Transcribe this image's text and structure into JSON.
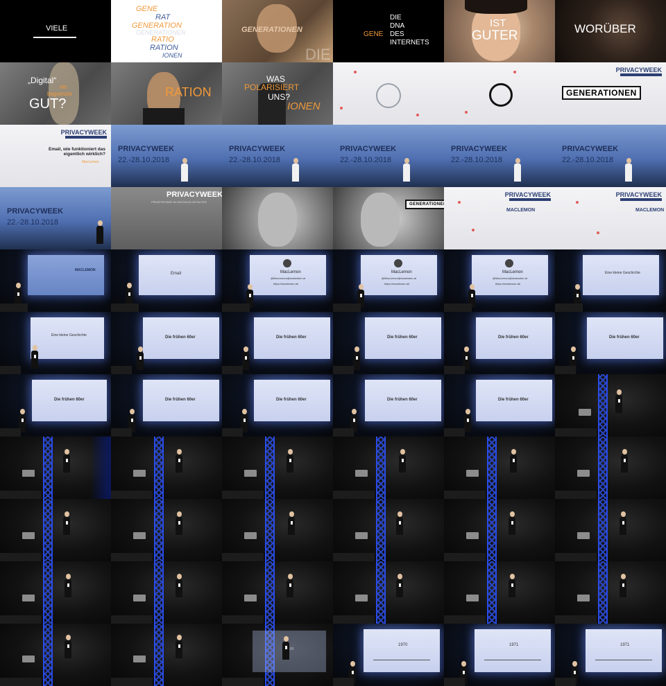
{
  "colors": {
    "accent_orange": "#f0993a",
    "accent_blue": "#3e5b99",
    "stage_truss": "#2c52ff"
  },
  "row1": {
    "c1": {
      "text": "VIELE"
    },
    "c2": {
      "words": [
        "GENE",
        "RAT",
        "GENERATION",
        "GENERATIONEN",
        "RATIO",
        "RATION",
        "IONEN"
      ]
    },
    "c3": {
      "overlay": "GENERATIONEN",
      "overlay2": "DIE"
    },
    "c4": {
      "left": "GENE",
      "right_lines": [
        "DIE",
        "DNA",
        "DES",
        "INTERNETS"
      ]
    },
    "c5": {
      "line1": "IST",
      "line2": "GUTER"
    },
    "c6": {
      "text": "WORÜBER"
    }
  },
  "row2": {
    "c1": {
      "quote": "„Digital“",
      "small1": "ein",
      "small2": "begrenzte",
      "big": "GUT?"
    },
    "c2": {
      "text": "RATION"
    },
    "c3": {
      "line1": "WAS",
      "line2": "POLARISIERT",
      "line3": "UNS?",
      "line4": "IONEN"
    },
    "c6": {
      "label": "GENERATIONEN"
    },
    "brand": "PRIVACYWEEK"
  },
  "row3": {
    "c1": {
      "brand": "PRIVACYWEEK",
      "question": "Email, wie funktioniert das eigentlich wirklich?",
      "author": "MacLemon"
    },
    "banner": {
      "title": "PRIVACYWEEK",
      "dates": "22.-28.10.2018"
    }
  },
  "row4": {
    "c1": {
      "title": "PRIVACYWEEK",
      "dates": "22.-28.10.2018"
    },
    "c2": {
      "title": "PRIVACYWEEK",
      "subtitle": "PRIVATSPHÄRE IM DIGITALEN ZEITALTER"
    },
    "c4": {
      "label": "GENERATIONEN"
    },
    "c5": {
      "brand": "PRIVACYWEEK",
      "name": "MACLEMON"
    },
    "c6": {
      "brand": "PRIVACYWEEK",
      "name": "MACLEMON"
    }
  },
  "stage_slides": {
    "maclemon": "MACLEMON",
    "email": "Email",
    "speaker": "MacLemon",
    "handle": "@MacLemon@mastodon.at",
    "site": "https://maclemon.at/",
    "story": "Eine kleine Geschichte",
    "sixties": "Die frühen 60er",
    "y1970": "1970",
    "y1971": "1971"
  }
}
